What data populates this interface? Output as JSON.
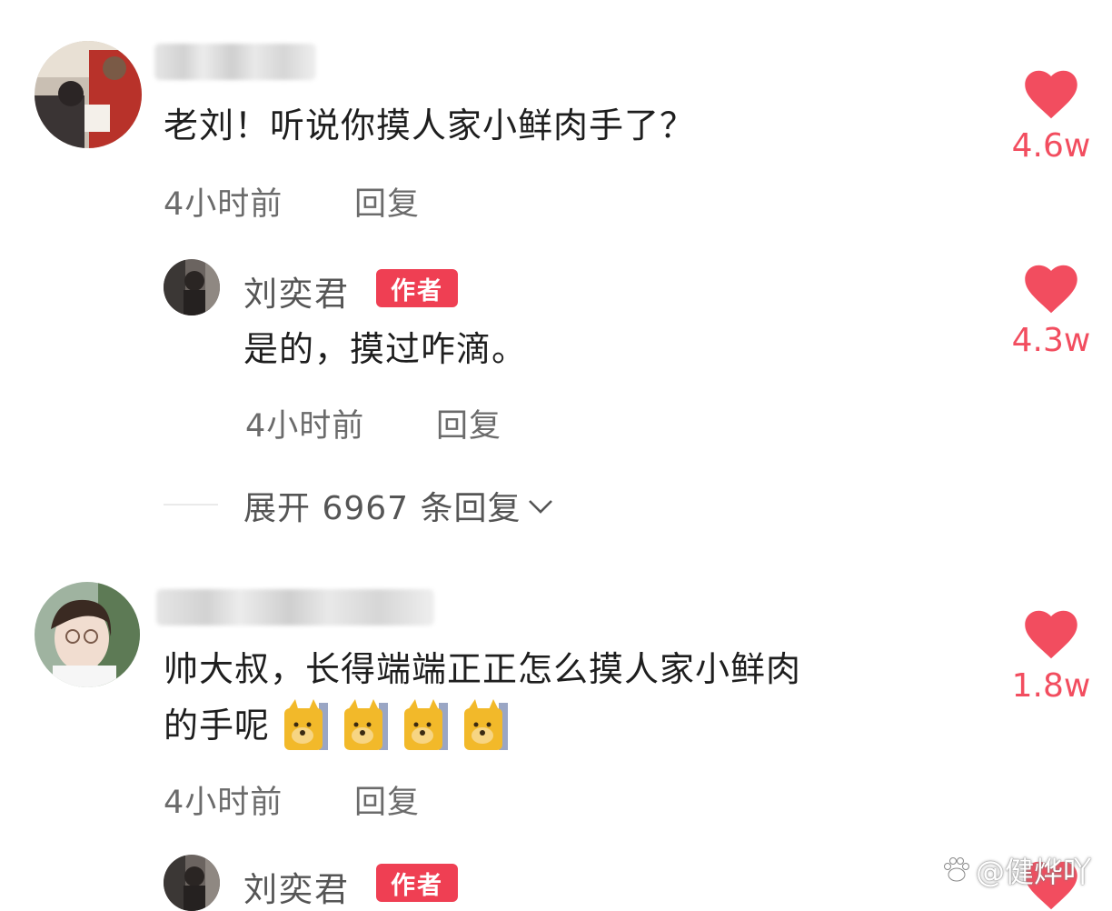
{
  "comments": [
    {
      "username_visible": false,
      "text": "老刘！听说你摸人家小鲜肉手了？",
      "time": "4小时前",
      "reply_label": "回复",
      "likes": "4.6w",
      "reply": {
        "author": "刘奕君",
        "badge": "作者",
        "text": "是的，摸过咋滴。",
        "time": "4小时前",
        "reply_label": "回复",
        "likes": "4.3w"
      },
      "expand_label": "展开 6967 条回复"
    },
    {
      "username_visible": false,
      "text_line1": "帅大叔，长得端端正正怎么摸人家小鲜肉",
      "text_line2": "的手呢",
      "emoji": [
        "doge-emoji",
        "doge-emoji",
        "doge-emoji",
        "doge-emoji"
      ],
      "time": "4小时前",
      "reply_label": "回复",
      "likes": "1.8w",
      "reply": {
        "author": "刘奕君",
        "badge": "作者"
      }
    }
  ],
  "watermark": "@健烨吖",
  "colors": {
    "accent_red": "#f24d5f",
    "badge_red": "#ef3f53",
    "meta_gray": "#6b6b6b"
  },
  "icons": {
    "like": "heart-icon",
    "expand": "chevron-down-icon",
    "watermark": "paw-logo-icon"
  }
}
